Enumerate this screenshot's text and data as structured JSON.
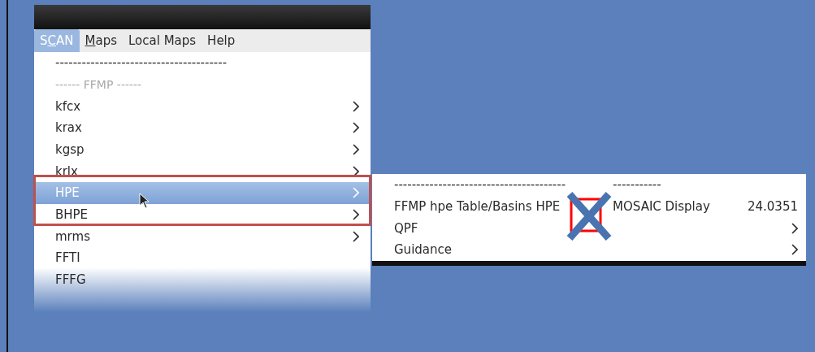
{
  "menubar": [
    {
      "parts": [
        {
          "text": "S",
          "underline": false
        },
        {
          "text": "C",
          "underline": true
        },
        {
          "text": "AN",
          "underline": false
        }
      ],
      "selected": true
    },
    {
      "parts": [
        {
          "text": "M",
          "underline": true
        },
        {
          "text": "aps",
          "underline": false
        }
      ],
      "selected": false
    },
    {
      "parts": [
        {
          "text": "Local Maps",
          "underline": false
        }
      ],
      "selected": false
    },
    {
      "parts": [
        {
          "text": "Help",
          "underline": false
        }
      ],
      "selected": false
    }
  ],
  "menu": [
    {
      "kind": "separator",
      "label": "---------------------------------------"
    },
    {
      "kind": "header",
      "label": "------ FFMP ------"
    },
    {
      "kind": "item",
      "label": "kfcx",
      "submenu": true,
      "selected": false
    },
    {
      "kind": "item",
      "label": "krax",
      "submenu": true,
      "selected": false
    },
    {
      "kind": "item",
      "label": "kgsp",
      "submenu": true,
      "selected": false
    },
    {
      "kind": "item",
      "label": "krlx",
      "submenu": true,
      "selected": false
    },
    {
      "kind": "item",
      "label": "HPE",
      "submenu": true,
      "selected": true
    },
    {
      "kind": "item",
      "label": "BHPE",
      "submenu": true,
      "selected": false
    },
    {
      "kind": "item",
      "label": "mrms",
      "submenu": true,
      "selected": false
    },
    {
      "kind": "item",
      "label": "FFTI",
      "submenu": false,
      "selected": false
    },
    {
      "kind": "item",
      "label": "FFFG",
      "submenu": false,
      "selected": false
    }
  ],
  "submenu": {
    "separator": {
      "left": "---------------------------------------",
      "right": "-----------"
    },
    "display_item": {
      "label": "FFMP hpe Table/Basins HPE",
      "label_after": "MOSAIC Display",
      "value": "24.0351"
    },
    "items": [
      {
        "label": "QPF",
        "submenu": true
      },
      {
        "label": "Guidance",
        "submenu": true
      }
    ]
  }
}
